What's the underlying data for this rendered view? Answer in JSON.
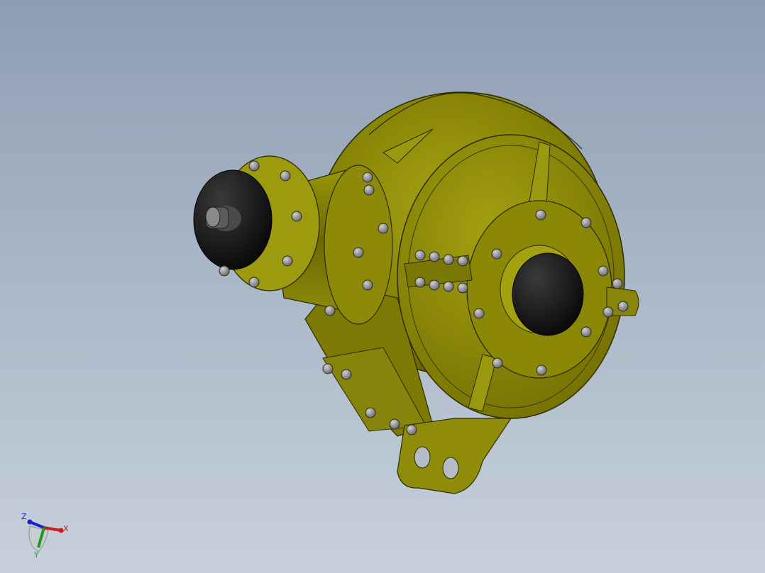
{
  "viewport": {
    "background_top": "#8e9eb2",
    "background_bottom": "#c7d1dc"
  },
  "model": {
    "body_color": "#8c8a08",
    "body_dark_color": "#4d4c00",
    "body_light_color": "#a8a614",
    "cover_color": "#151515",
    "bolt_color": "#9a9a9a"
  },
  "triad": {
    "x_label": "X",
    "y_label": "Y",
    "z_label": "Z",
    "x_color": "#c81e1e",
    "y_color": "#1e9a1e",
    "z_color": "#1e1ec8"
  }
}
